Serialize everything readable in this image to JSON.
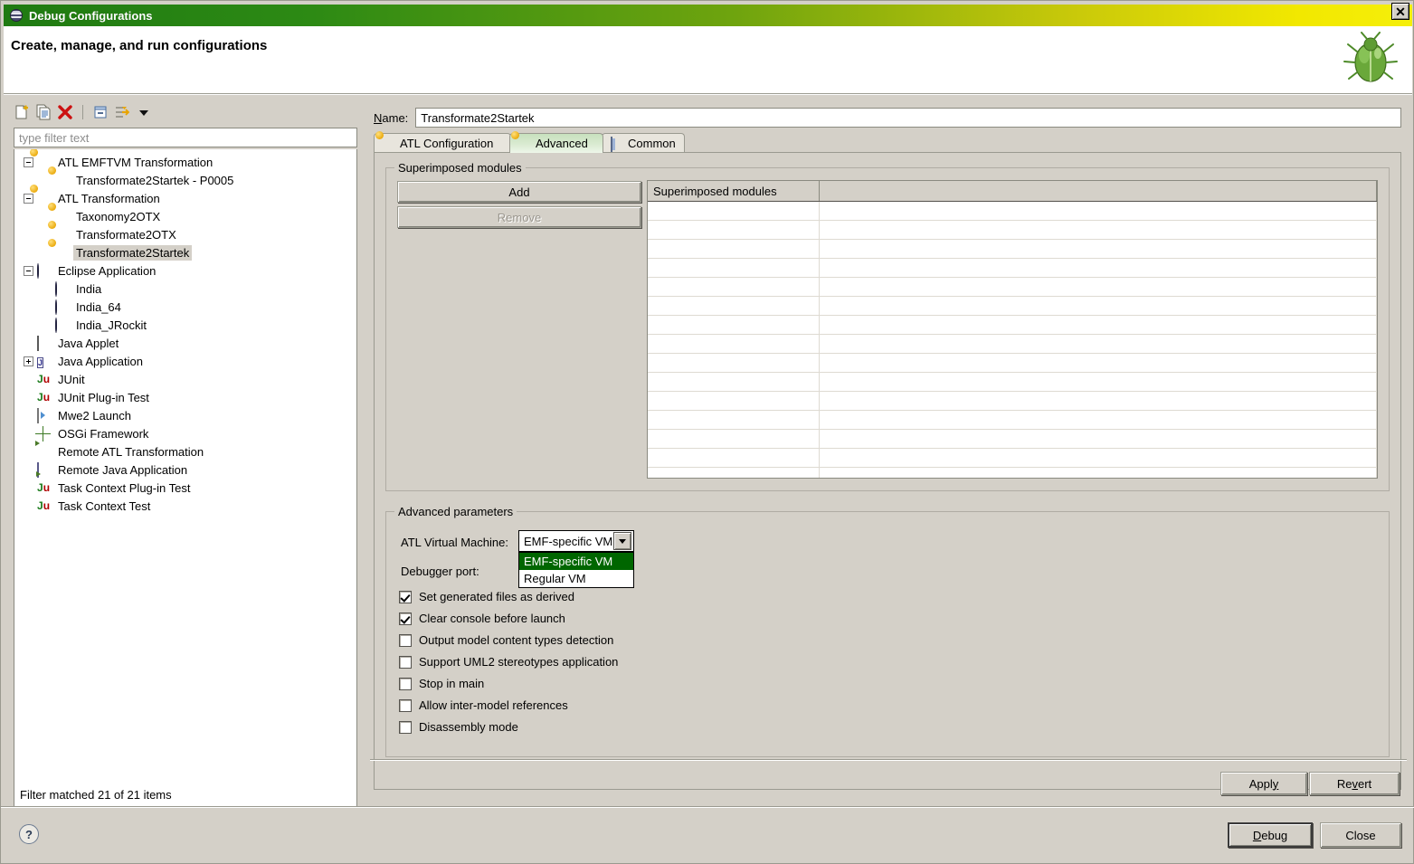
{
  "window": {
    "title": "Debug Configurations",
    "title_icon": "eclipse-disc-icon",
    "close_label": "✕",
    "heading": "Create, manage, and run configurations",
    "decor_icon": "green-bug-icon"
  },
  "left": {
    "toolbar": [
      {
        "name": "new-configuration-icon",
        "tip": "New launch configuration"
      },
      {
        "name": "duplicate-configuration-icon",
        "tip": "Duplicate"
      },
      {
        "name": "delete-configuration-icon",
        "tip": "Delete"
      },
      {
        "name": "collapse-all-icon",
        "tip": "Collapse All"
      },
      {
        "name": "filter-icon",
        "tip": "Filter launch configurations"
      },
      {
        "name": "chevron-down-icon",
        "tip": "View Menu"
      }
    ],
    "filter": {
      "value": "",
      "placeholder": "type filter text"
    },
    "tree": [
      {
        "label": "ATL EMFTVM Transformation",
        "indent": 0,
        "expander": "minus",
        "icon": "atl-emftvm-icon",
        "selected": false
      },
      {
        "label": "Transformate2Startek - P0005",
        "indent": 1,
        "expander": "none",
        "icon": "atl-emftvm-icon",
        "selected": false
      },
      {
        "label": "ATL Transformation",
        "indent": 0,
        "expander": "minus",
        "icon": "atl-icon",
        "selected": false
      },
      {
        "label": "Taxonomy2OTX",
        "indent": 1,
        "expander": "none",
        "icon": "atl-icon",
        "selected": false
      },
      {
        "label": "Transformate2OTX",
        "indent": 1,
        "expander": "none",
        "icon": "atl-icon",
        "selected": false
      },
      {
        "label": "Transformate2Startek",
        "indent": 1,
        "expander": "none",
        "icon": "atl-icon",
        "selected": true
      },
      {
        "label": "Eclipse Application",
        "indent": 0,
        "expander": "minus",
        "icon": "eclipse-icon",
        "selected": false
      },
      {
        "label": "India",
        "indent": 1,
        "expander": "none",
        "icon": "eclipse-icon",
        "selected": false
      },
      {
        "label": "India_64",
        "indent": 1,
        "expander": "none",
        "icon": "eclipse-icon",
        "selected": false
      },
      {
        "label": "India_JRockit",
        "indent": 1,
        "expander": "none",
        "icon": "eclipse-icon",
        "selected": false
      },
      {
        "label": "Java Applet",
        "indent": 0,
        "expander": "none",
        "icon": "java-applet-icon",
        "selected": false
      },
      {
        "label": "Java Application",
        "indent": 0,
        "expander": "plus",
        "icon": "java-application-icon",
        "selected": false
      },
      {
        "label": "JUnit",
        "indent": 0,
        "expander": "none",
        "icon": "junit-icon",
        "selected": false
      },
      {
        "label": "JUnit Plug-in Test",
        "indent": 0,
        "expander": "none",
        "icon": "junit-plugin-icon",
        "selected": false
      },
      {
        "label": "Mwe2 Launch",
        "indent": 0,
        "expander": "none",
        "icon": "mwe2-icon",
        "selected": false
      },
      {
        "label": "OSGi Framework",
        "indent": 0,
        "expander": "none",
        "icon": "osgi-icon",
        "selected": false
      },
      {
        "label": "Remote ATL Transformation",
        "indent": 0,
        "expander": "none",
        "icon": "remote-atl-icon",
        "selected": false
      },
      {
        "label": "Remote Java Application",
        "indent": 0,
        "expander": "none",
        "icon": "remote-java-icon",
        "selected": false
      },
      {
        "label": "Task Context Plug-in Test",
        "indent": 0,
        "expander": "none",
        "icon": "task-context-plugin-icon",
        "selected": false
      },
      {
        "label": "Task Context Test",
        "indent": 0,
        "expander": "none",
        "icon": "task-context-icon",
        "selected": false
      }
    ],
    "status": "Filter matched 21 of 21 items"
  },
  "right": {
    "name_label": "Name:",
    "name_label_mnemonic": "N",
    "name_label_rest": "ame:",
    "name_value": "Transformate2Startek",
    "tabs": [
      {
        "label": "ATL Configuration",
        "icon": "atl-icon",
        "active": false
      },
      {
        "label": "Advanced",
        "icon": "atl-icon",
        "active": true
      },
      {
        "label": "Common",
        "icon": "common-icon",
        "active": false
      }
    ],
    "superimposed": {
      "group_label": "Superimposed modules",
      "add_label": "Add",
      "remove_label": "Remove",
      "remove_enabled": false,
      "columns": [
        "Superimposed modules",
        ""
      ],
      "rows": [],
      "empty_row_count": 16
    },
    "advanced": {
      "group_label": "Advanced parameters",
      "vm_label": "ATL Virtual Machine:",
      "vm_value": "EMF-specific VM",
      "vm_options": [
        "EMF-specific VM",
        "Regular VM"
      ],
      "vm_selected_index": 0,
      "vm_dropdown_open": true,
      "debugger_port_label": "Debugger port:",
      "debugger_port_value": "",
      "checkboxes": [
        {
          "label": "Set generated files as derived",
          "checked": true
        },
        {
          "label": "Clear console before launch",
          "checked": true
        },
        {
          "label": "Output model content types detection",
          "checked": false
        },
        {
          "label": "Support UML2 stereotypes application",
          "checked": false
        },
        {
          "label": "Stop in main",
          "checked": false
        },
        {
          "label": "Allow inter-model references",
          "checked": false
        },
        {
          "label": "Disassembly mode",
          "checked": false
        }
      ]
    },
    "apply_label": "Apply",
    "apply_mnemonic_pre": "Appl",
    "apply_mnemonic": "y",
    "revert_label": "Revert",
    "revert_pre": "Re",
    "revert_mn": "v",
    "revert_post": "ert"
  },
  "footer": {
    "help_label": "?",
    "debug_pre": "",
    "debug_mn": "D",
    "debug_post": "ebug",
    "debug_label": "Debug",
    "close_label": "Close"
  },
  "colors": {
    "title_start": "#1f7a12",
    "title_end": "#f5ef0a",
    "dropdown_highlight": "#006600",
    "face": "#d4d0c8",
    "tab_active": "#cfe7c6"
  }
}
